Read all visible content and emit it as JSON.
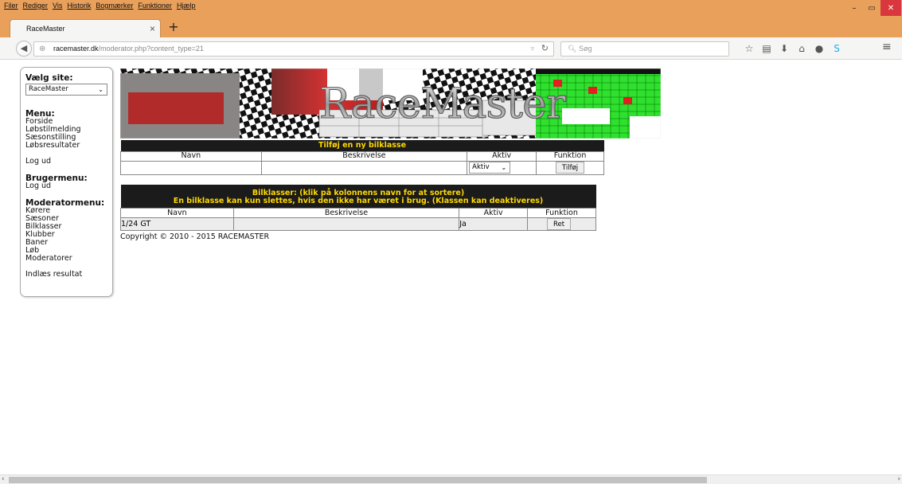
{
  "colors": {
    "titlebar": "#e9a05b",
    "table_header_bg": "#1b1b1b",
    "table_header_text": "#ffd900",
    "close_button": "#d8383d"
  },
  "menubar": [
    "Filer",
    "Rediger",
    "Vis",
    "Historik",
    "Bogmærker",
    "Funktioner",
    "Hjælp"
  ],
  "tab": {
    "title": "RaceMaster"
  },
  "address": {
    "host": "racemaster.dk",
    "path": "/moderator.php?content_type=21"
  },
  "search": {
    "placeholder": "Søg"
  },
  "sidebar": {
    "site_label": "Vælg site:",
    "site_value": "RaceMaster",
    "menu_title": "Menu:",
    "menu_items": [
      "Forside",
      "Løbstilmelding",
      "Sæsonstilling",
      "Løbsresultater"
    ],
    "logout": "Log ud",
    "user_menu_title": "Brugermenu:",
    "user_menu_items": [
      "Log ud"
    ],
    "moderator_title": "Moderatormenu:",
    "moderator_items": [
      "Kørere",
      "Sæsoner",
      "Bilklasser",
      "Klubber",
      "Baner",
      "Løb",
      "Moderatorer"
    ],
    "import": "Indlæs resultat"
  },
  "banner": {
    "logo_text": "RaceMaster"
  },
  "add_table": {
    "title": "Tilføj en ny bilklasse",
    "headers": [
      "Navn",
      "Beskrivelse",
      "Aktiv",
      "Funktion"
    ],
    "aktiv_value": "Aktiv",
    "button": "Tilføj"
  },
  "list_table": {
    "title_line1": "Bilklasser: (klik på kolonnens navn for at sortere)",
    "title_line2": "En bilklasse kan kun slettes, hvis den ikke har været i brug. (Klassen kan deaktiveres)",
    "headers": [
      "Navn",
      "Beskrivelse",
      "Aktiv",
      "Funktion"
    ],
    "rows": [
      {
        "navn": "1/24 GT",
        "beskrivelse": "",
        "aktiv": "Ja",
        "button": "Ret"
      }
    ]
  },
  "copyright": "Copyright © 2010 - 2015 RACEMASTER"
}
